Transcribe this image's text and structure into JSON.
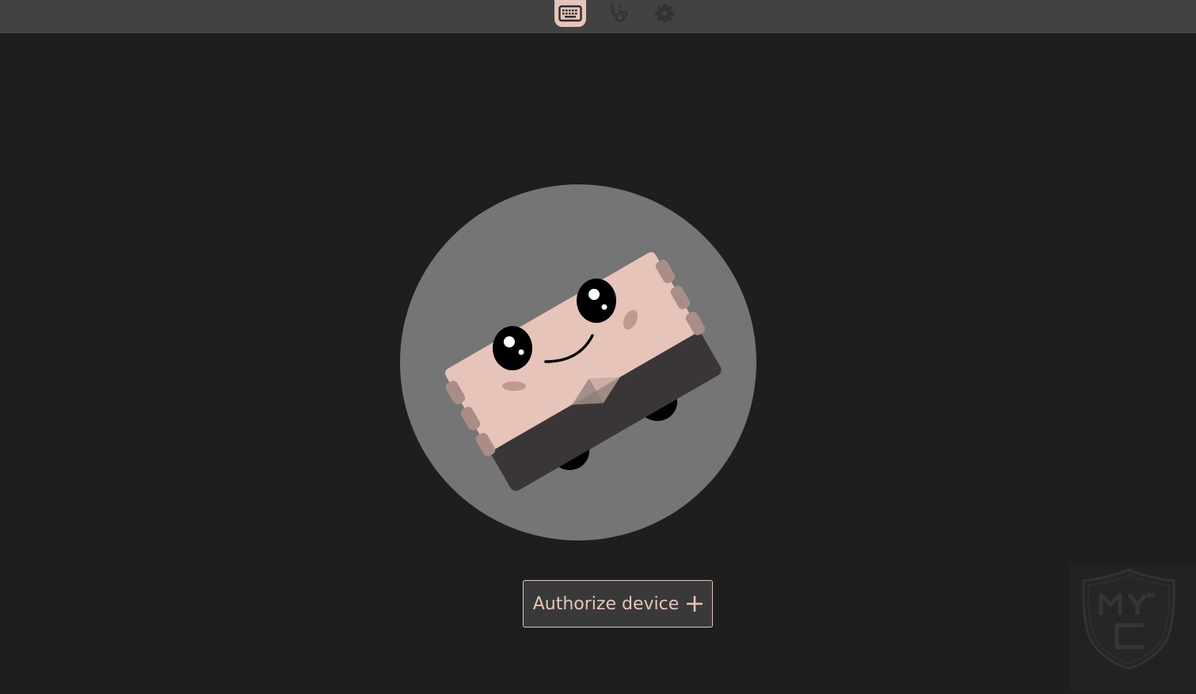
{
  "topbar": {
    "tabs": [
      {
        "name": "keyboard",
        "icon": "keyboard-icon",
        "active": true
      },
      {
        "name": "diagnostics",
        "icon": "stethoscope-icon",
        "active": false
      },
      {
        "name": "settings",
        "icon": "gear-icon",
        "active": false
      }
    ]
  },
  "main": {
    "illustration": "keyboard-mascot",
    "authorize_label": "Authorize device",
    "authorize_icon": "plus-icon"
  },
  "watermark": {
    "logo": "myc-shield-logo"
  },
  "colors": {
    "background": "#1e1e1f",
    "topbar": "#424242",
    "accent": "#e7c4ba",
    "circle": "#757575",
    "button_bg": "#3a3939",
    "icon_inactive": "#333333"
  }
}
